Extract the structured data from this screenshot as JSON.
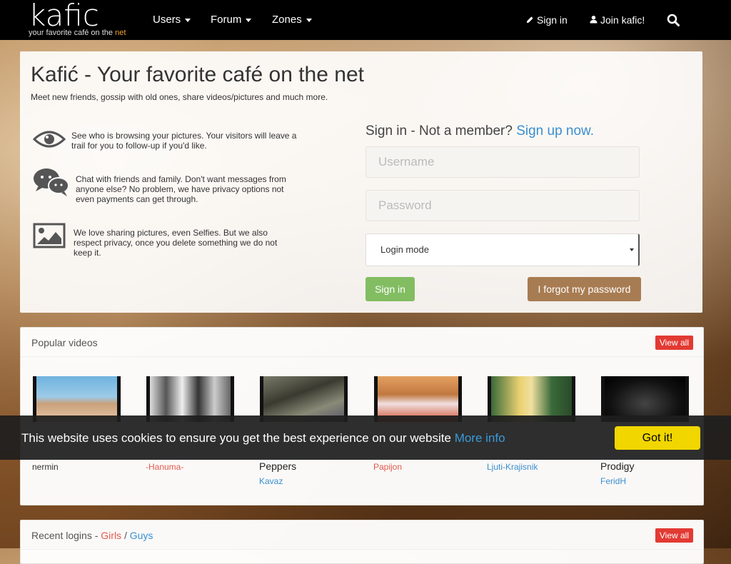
{
  "nav": {
    "logo": "kafic",
    "tagline_prefix": "your favorite café on the ",
    "tagline_net": "net",
    "menu": [
      {
        "label": "Users"
      },
      {
        "label": "Forum"
      },
      {
        "label": "Zones"
      }
    ],
    "signin": "Sign in",
    "join": "Join kafic!"
  },
  "hero": {
    "title": "Kafić - Your favorite café on the net",
    "subtitle": "Meet new friends, gossip with old ones, share videos/pictures and much more.",
    "features": [
      {
        "icon": "eye-icon",
        "text": "See who is browsing your pictures. Your visitors will leave a trail for you to follow-up if you'd like."
      },
      {
        "icon": "chat-icon",
        "text": "Chat with friends and family. Don't want messages from anyone else? No problem, we have privacy options not even payments can get through."
      },
      {
        "icon": "picture-icon",
        "text": "We love sharing pictures, even Selfies. But we also respect privacy, once you delete something we do not keep it."
      }
    ]
  },
  "login": {
    "title": "Sign in - Not a member? ",
    "signup_link": "Sign up now.",
    "username_placeholder": "Username",
    "password_placeholder": "Password",
    "mode_value": "Login mode",
    "signin_button": "Sign in",
    "forgot_button": "I forgot my password"
  },
  "videos": {
    "title": "Popular videos",
    "view_all": "View all",
    "items": [
      {
        "title": "",
        "user": "nermin",
        "user_color": "#3a8fd0"
      },
      {
        "title": "",
        "user": "-Hanuma-",
        "user_color": "#e35a4e"
      },
      {
        "title": "Peppers",
        "user": "Kavaz",
        "user_color": "#3a8fd0"
      },
      {
        "title": "",
        "user": "Papijon",
        "user_color": "#e35a4e"
      },
      {
        "title": "",
        "user": "Ljuti-Krajisnik",
        "user_color": "#3a8fd0"
      },
      {
        "title": "Prodigy",
        "user": "FeridH",
        "user_color": "#3a8fd0"
      }
    ]
  },
  "recent": {
    "prefix": "Recent logins - ",
    "girls": "Girls",
    "sep": " / ",
    "guys": "Guys",
    "view_all": "View all"
  },
  "cookie": {
    "text": "This website uses cookies to ensure you get the best experience on our website ",
    "more": "More info",
    "button": "Got it!"
  }
}
